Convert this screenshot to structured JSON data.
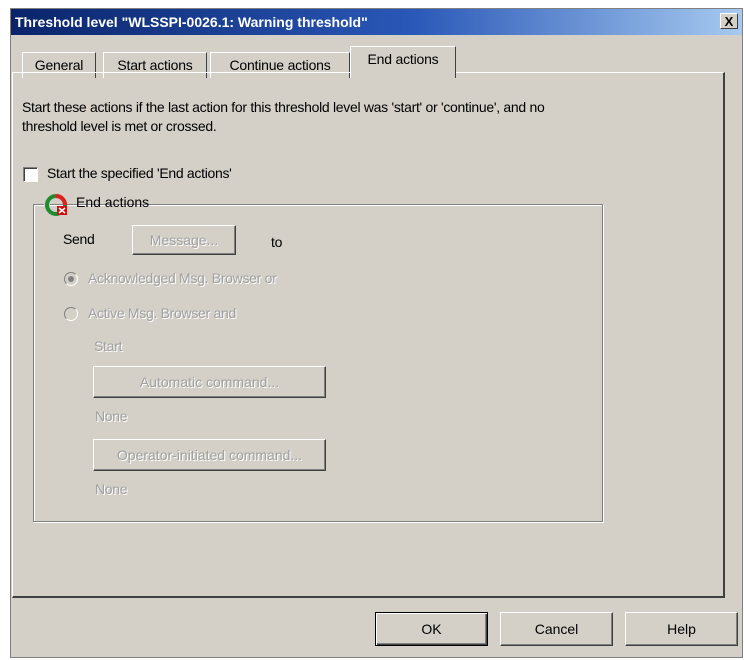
{
  "window": {
    "title": "Threshold level \"WLSSPI-0026.1: Warning threshold\"",
    "close_label": "X"
  },
  "tabs": [
    {
      "label": "General",
      "active": false
    },
    {
      "label": "Start actions",
      "active": false
    },
    {
      "label": "Continue actions",
      "active": false
    },
    {
      "label": "End actions",
      "active": true
    }
  ],
  "panel": {
    "description": "Start these actions if the last action for this threshold level was 'start' or 'continue', and no threshold level is met or crossed.",
    "checkbox_label": "Start the specified 'End actions'",
    "checkbox_checked": false,
    "group_title": "End actions",
    "send_label": "Send",
    "message_button": "Message...",
    "to_label": "to",
    "radio_acknowledged": "Acknowledged Msg. Browser or",
    "radio_active": "Active Msg. Browser and",
    "start_label": "Start",
    "automatic_command_button": "Automatic command...",
    "automatic_value": "None",
    "operator_command_button": "Operator-initiated command...",
    "operator_value": "None"
  },
  "footer": {
    "ok": "OK",
    "cancel": "Cancel",
    "help": "Help"
  },
  "colors": {
    "titlebar_start": "#0a246a",
    "dialog_face": "#d4d0c8",
    "disabled_text": "#a0a0a0"
  }
}
